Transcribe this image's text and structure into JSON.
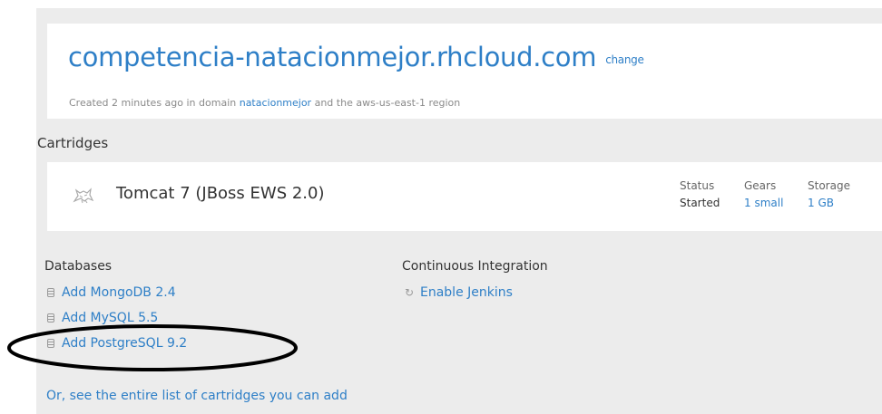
{
  "app": {
    "title": "competencia-natacionmejor.rhcloud.com",
    "change_label": "change",
    "meta_prefix": "Created 2 minutes ago in domain ",
    "domain": "natacionmejor",
    "meta_suffix": " and the aws-us-east-1 region"
  },
  "cartridges": {
    "heading": "Cartridges",
    "items": [
      {
        "icon": "tomcat-icon",
        "name": "Tomcat 7 (JBoss EWS 2.0)",
        "status_label": "Status",
        "status_value": "Started",
        "gears_label": "Gears",
        "gears_value": "1 small",
        "storage_label": "Storage",
        "storage_value": "1 GB"
      }
    ]
  },
  "databases": {
    "heading": "Databases",
    "items": [
      {
        "label": "Add MongoDB 2.4",
        "icon": "database-icon"
      },
      {
        "label": "Add MySQL 5.5",
        "icon": "database-icon"
      },
      {
        "label": "Add PostgreSQL 9.2",
        "icon": "database-icon"
      }
    ]
  },
  "ci": {
    "heading": "Continuous Integration",
    "items": [
      {
        "label": "Enable Jenkins",
        "icon": "refresh-icon"
      }
    ]
  },
  "footer": {
    "see_all_label": "Or, see the entire list of cartridges you can add"
  },
  "colors": {
    "link": "#2e7fc7",
    "panel_bg": "#ececec",
    "card_bg": "#ffffff",
    "annotation": "#000000"
  }
}
